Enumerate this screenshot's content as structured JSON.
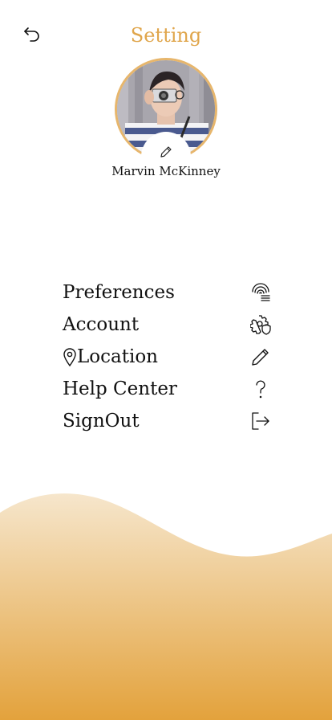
{
  "header": {
    "back_icon": "undo-arrow-icon",
    "title": "Setting"
  },
  "profile": {
    "name": "Marvin McKinney",
    "edit_icon": "pencil-icon"
  },
  "menu": {
    "items": [
      {
        "label": "Preferences",
        "icon": "fingerprint-icon"
      },
      {
        "label": "Account",
        "icon": "gear-shield-icon"
      },
      {
        "label": "Location",
        "icon": "pencil-icon",
        "leading_icon": "map-pin-icon"
      },
      {
        "label": "Help Center",
        "icon": "question-mark-icon"
      },
      {
        "label": "SignOut",
        "icon": "logout-icon"
      }
    ]
  },
  "colors": {
    "accent": "#e0a64c",
    "wave_top": "#f6e6cc",
    "wave_bottom": "#e3a23c"
  }
}
